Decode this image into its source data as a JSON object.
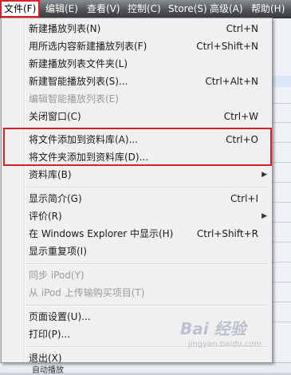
{
  "menubar": {
    "items": [
      {
        "label": "文件(F)"
      },
      {
        "label": "编辑(E)"
      },
      {
        "label": "查看(V)"
      },
      {
        "label": "控制(C)"
      },
      {
        "label": "Store(S)"
      },
      {
        "label": "高级(A)"
      },
      {
        "label": "帮助(H)"
      }
    ]
  },
  "file_menu": {
    "items": [
      {
        "label": "新建播放列表(N)",
        "shortcut": "Ctrl+N"
      },
      {
        "label": "用所选内容新建播放列表(F)",
        "shortcut": "Ctrl+Shift+N"
      },
      {
        "label": "新建播放列表文件夹(L)",
        "shortcut": ""
      },
      {
        "label": "新建智能播放列表(S)...",
        "shortcut": "Ctrl+Alt+N"
      },
      {
        "label": "编辑智能播放列表(E)",
        "shortcut": "",
        "disabled": true
      },
      {
        "label": "关闭窗口(C)",
        "shortcut": "Ctrl+W"
      },
      {
        "label": "将文件添加到资料库(A)...",
        "shortcut": "Ctrl+O"
      },
      {
        "label": "将文件夹添加到资料库(D)...",
        "shortcut": ""
      },
      {
        "label": "资料库(B)",
        "shortcut": "",
        "submenu": true
      },
      {
        "label": "显示简介(G)",
        "shortcut": "Ctrl+I"
      },
      {
        "label": "评价(R)",
        "shortcut": "",
        "submenu": true
      },
      {
        "label": "在 Windows Explorer 中显示(H)",
        "shortcut": "Ctrl+Shift+R"
      },
      {
        "label": "显示重复项(I)",
        "shortcut": ""
      },
      {
        "label": "同步 iPod(Y)",
        "shortcut": "",
        "disabled": true
      },
      {
        "label": "从 iPod 上传输购买项目(T)",
        "shortcut": "",
        "disabled": true
      },
      {
        "label": "页面设置(U)...",
        "shortcut": ""
      },
      {
        "label": "打印(P)...",
        "shortcut": ""
      },
      {
        "label": "退出(X)",
        "shortcut": ""
      }
    ]
  },
  "submenu_arrow": "▶",
  "watermark": {
    "big": "Bai 经验",
    "small": "jingyan.baidu.com"
  },
  "bottom_strip": "自动播放",
  "colors": {
    "highlight_border": "#d8202a",
    "menubar": "#4e5155",
    "menu_bg": "#f0f0f0"
  }
}
